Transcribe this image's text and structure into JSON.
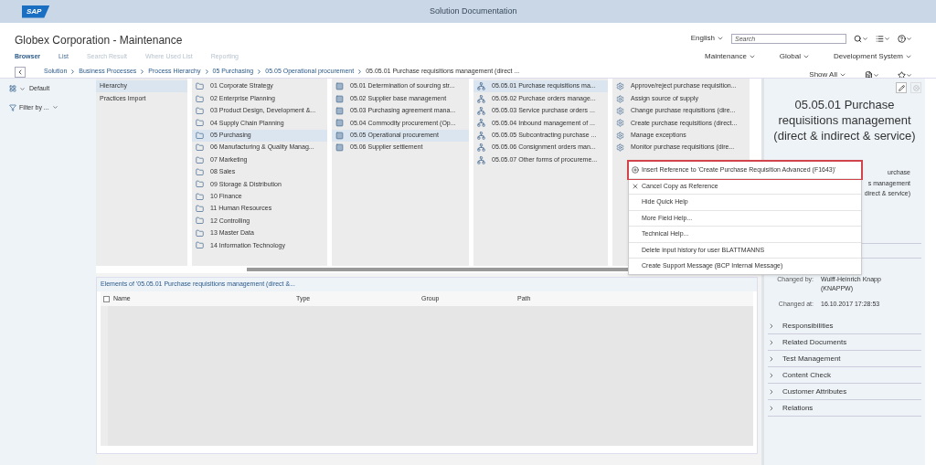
{
  "shell": {
    "logo": "SAP",
    "title": "Solution Documentation"
  },
  "header": {
    "title": "Globex Corporation - Maintenance",
    "language": "English",
    "search": {
      "placeholder": "Search"
    },
    "tabs": [
      {
        "label": "Browser",
        "selected": true,
        "disabled": false
      },
      {
        "label": "List",
        "selected": false,
        "disabled": false
      },
      {
        "label": "Search Result",
        "selected": false,
        "disabled": true
      },
      {
        "label": "Where Used List",
        "selected": false,
        "disabled": true
      },
      {
        "label": "Reporting",
        "selected": false,
        "disabled": true
      }
    ],
    "context": [
      "Maintenance",
      "Global",
      "Development System"
    ],
    "breadcrumb": [
      "Solution",
      "Business Processes",
      "Process Hierarchy",
      "05 Purchasing",
      "05.05 Operational procurement",
      "05.05.01 Purchase requisitions management (direct ..."
    ],
    "show_all": "Show All"
  },
  "sidebar": {
    "view": "Default",
    "filter": "Filter by ..."
  },
  "columns": [
    {
      "kind": "plain",
      "items": [
        {
          "label": "Hierarchy",
          "selected": true
        },
        {
          "label": "Practices Import",
          "selected": false
        }
      ]
    },
    {
      "kind": "folder",
      "items": [
        {
          "label": "01 Corporate Strategy",
          "selected": false
        },
        {
          "label": "02 Enterprise Planning",
          "selected": false
        },
        {
          "label": "03 Product Design, Development &...",
          "selected": false
        },
        {
          "label": "04 Supply Chain Planning",
          "selected": false
        },
        {
          "label": "05 Purchasing",
          "selected": true
        },
        {
          "label": "06 Manufacturing & Quality Manag...",
          "selected": false
        },
        {
          "label": "07 Marketing",
          "selected": false
        },
        {
          "label": "08 Sales",
          "selected": false
        },
        {
          "label": "09 Storage & Distribution",
          "selected": false
        },
        {
          "label": "10 Finance",
          "selected": false
        },
        {
          "label": "11 Human Resources",
          "selected": false
        },
        {
          "label": "12 Controlling",
          "selected": false
        },
        {
          "label": "13 Master Data",
          "selected": false
        },
        {
          "label": "14 Information Technology",
          "selected": false
        }
      ]
    },
    {
      "kind": "box",
      "items": [
        {
          "label": "05.01 Determination of sourcing str...",
          "selected": false
        },
        {
          "label": "05.02 Supplier base management",
          "selected": false
        },
        {
          "label": "05.03 Purchasing agreement mana...",
          "selected": false
        },
        {
          "label": "05.04 Commodity procurement (Op...",
          "selected": false
        },
        {
          "label": "05.05 Operational procurement",
          "selected": true
        },
        {
          "label": "05.06 Supplier settlement",
          "selected": false
        }
      ]
    },
    {
      "kind": "process",
      "items": [
        {
          "label": "05.05.01 Purchase requisitions ma...",
          "selected": true
        },
        {
          "label": "05.05.02 Purchase orders  manage...",
          "selected": false
        },
        {
          "label": "05.05.03 Service purchase orders ...",
          "selected": false
        },
        {
          "label": "05.05.04 Inbound management of ...",
          "selected": false
        },
        {
          "label": "05.05.05 Subcontracting purchase ...",
          "selected": false
        },
        {
          "label": "05.05.06 Consignment orders man...",
          "selected": false
        },
        {
          "label": "05.05.07 Other forms of procureme...",
          "selected": false
        }
      ]
    },
    {
      "kind": "step",
      "items": [
        {
          "label": "Approve/reject purchase requisition...",
          "selected": false
        },
        {
          "label": "Assign source of  supply",
          "selected": false
        },
        {
          "label": "Change purchase requisitions (dire...",
          "selected": false
        },
        {
          "label": "Create purchase requisitions (direct...",
          "selected": false
        },
        {
          "label": "Manage exceptions",
          "selected": false
        },
        {
          "label": "Monitor purchase requisitions (dire...",
          "selected": false
        }
      ]
    }
  ],
  "elements": {
    "title": "Elements of '05.05.01 Purchase requisitions management (direct &...",
    "columns": [
      "Name",
      "Type",
      "Group",
      "Path"
    ],
    "select_all_checked": false
  },
  "context_menu": [
    {
      "label": "Insert Reference to 'Create Purchase Requisition Advanced (F1643)'",
      "kind": "insert",
      "highlighted": true
    },
    {
      "label": "Cancel Copy as Reference",
      "kind": "cancel",
      "highlighted": false
    },
    {
      "label": "Hide Quick Help",
      "kind": "plain",
      "highlighted": false
    },
    {
      "label": "More Field Help...",
      "kind": "plain",
      "highlighted": false
    },
    {
      "label": "Technical Help...",
      "kind": "plain",
      "highlighted": false
    },
    {
      "label": "Delete input history for user BLATTMANNS",
      "kind": "plain",
      "highlighted": false
    },
    {
      "label": "Create Support Message (BCP Internal Message)",
      "kind": "plain",
      "highlighted": false
    }
  ],
  "detail": {
    "title": "05.05.01 Purchase requisitions management (direct & indirect & service)",
    "description_fragments": [
      "urchase",
      "s management",
      "direct & service)"
    ],
    "fields": [
      {
        "label": "Changed by:",
        "value": "Wulff-Heinrich Knapp (KNAPPW)"
      },
      {
        "label": "Changed at:",
        "value": "16.10.2017 17:28:53"
      }
    ],
    "sections": [
      {
        "label": "Responsibilities",
        "expanded": false
      },
      {
        "label": "Related Documents",
        "expanded": false
      },
      {
        "label": "Test Management",
        "expanded": false
      },
      {
        "label": "Content Check",
        "expanded": false
      },
      {
        "label": "Customer Attributes",
        "expanded": false
      },
      {
        "label": "Relations",
        "expanded": false
      }
    ]
  }
}
